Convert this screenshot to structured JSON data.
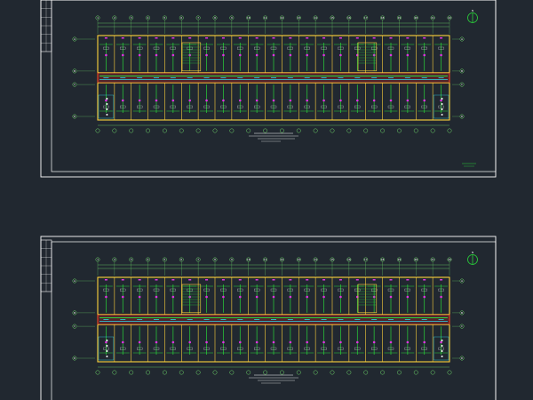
{
  "colors": {
    "background": "#212830",
    "frame": "#ffffff",
    "wall": "#ffd23c",
    "corridor": "#e8171b",
    "pipe": "#2ad43a",
    "fixture": "#e033e3",
    "cyan": "#30d6e8",
    "dim": "#6fd86a"
  },
  "sheets": [
    {
      "id": "sheet-1",
      "grid_axes": [
        "1",
        "2",
        "3",
        "4",
        "5",
        "6",
        "7",
        "8",
        "9",
        "10",
        "11",
        "12",
        "13",
        "14",
        "15",
        "16",
        "17",
        "18",
        "19",
        "20",
        "21",
        "22"
      ],
      "row_axes": [
        "A",
        "B",
        "C",
        "D"
      ],
      "north_label": "N",
      "caption_lines": [],
      "corner_note": ""
    },
    {
      "id": "sheet-2",
      "grid_axes": [
        "1",
        "2",
        "3",
        "4",
        "5",
        "6",
        "7",
        "8",
        "9",
        "10",
        "11",
        "12",
        "13",
        "14",
        "15",
        "16",
        "17",
        "18",
        "19",
        "20",
        "21",
        "22"
      ],
      "row_axes": [
        "A",
        "B",
        "C",
        "D"
      ],
      "north_label": "N",
      "caption_lines": [],
      "corner_note": ""
    }
  ]
}
